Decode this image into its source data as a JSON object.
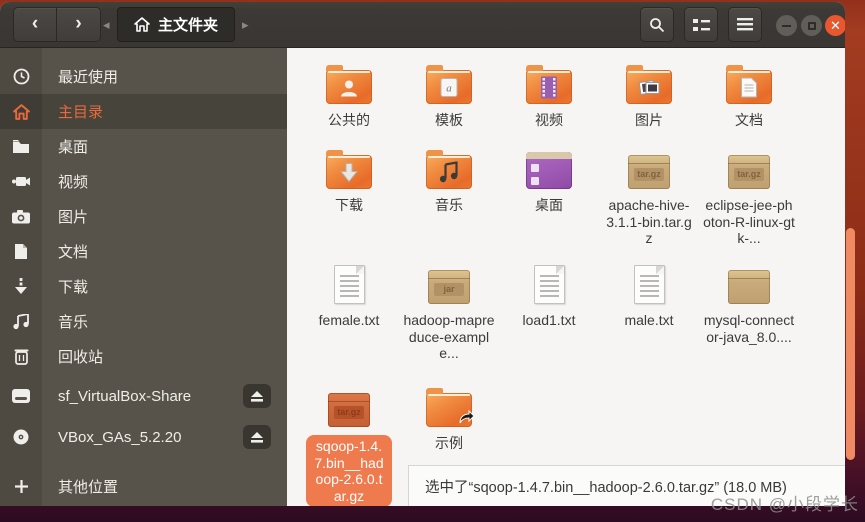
{
  "toolbar": {
    "path_label": "主文件夹"
  },
  "sidebar": {
    "items": [
      {
        "label": "最近使用"
      },
      {
        "label": "主目录",
        "selected": true
      },
      {
        "label": "桌面"
      },
      {
        "label": "视频"
      },
      {
        "label": "图片"
      },
      {
        "label": "文档"
      },
      {
        "label": "下载"
      },
      {
        "label": "音乐"
      },
      {
        "label": "回收站"
      },
      {
        "label": "sf_VirtualBox-Share",
        "eject": true
      },
      {
        "label": "VBox_GAs_5.2.20",
        "eject": true
      },
      {
        "label": "其他位置"
      }
    ]
  },
  "files": {
    "rows": [
      {
        "items": [
          {
            "name": "公共的"
          },
          {
            "name": "模板"
          },
          {
            "name": "视频"
          },
          {
            "name": "图片"
          },
          {
            "name": "文档"
          }
        ]
      },
      {
        "items": [
          {
            "name": "下载"
          },
          {
            "name": "音乐"
          },
          {
            "name": "桌面"
          },
          {
            "name": "apache-hive-3.1.1-bin.tar.gz",
            "badge": "tar.gz"
          },
          {
            "name": "eclipse-jee-photon-R-linux-gtk-...",
            "badge": "tar.gz"
          }
        ]
      },
      {
        "items": [
          {
            "name": "female.txt"
          },
          {
            "name": "hadoop-mapreduce-example...",
            "badge": "jar"
          },
          {
            "name": "load1.txt"
          },
          {
            "name": "male.txt"
          },
          {
            "name": "mysql-connector-java_8.0...."
          }
        ]
      },
      {
        "items": [
          {
            "name": "sqoop-1.4.7.bin__hadoop-2.6.0.tar.gz",
            "badge": "tar.gz",
            "selected": true
          },
          {
            "name": "示例"
          }
        ]
      }
    ]
  },
  "statusbar": {
    "text": "选中了“sqoop-1.4.7.bin__hadoop-2.6.0.tar.gz” (18.0 MB)"
  },
  "watermark": {
    "text": "CSDN @小段学长"
  },
  "colors": {
    "accent": "#E95420",
    "selection_pill": "#EF7A4E",
    "close_button": "#E9572E",
    "sidebar_bg": "#57534A"
  }
}
